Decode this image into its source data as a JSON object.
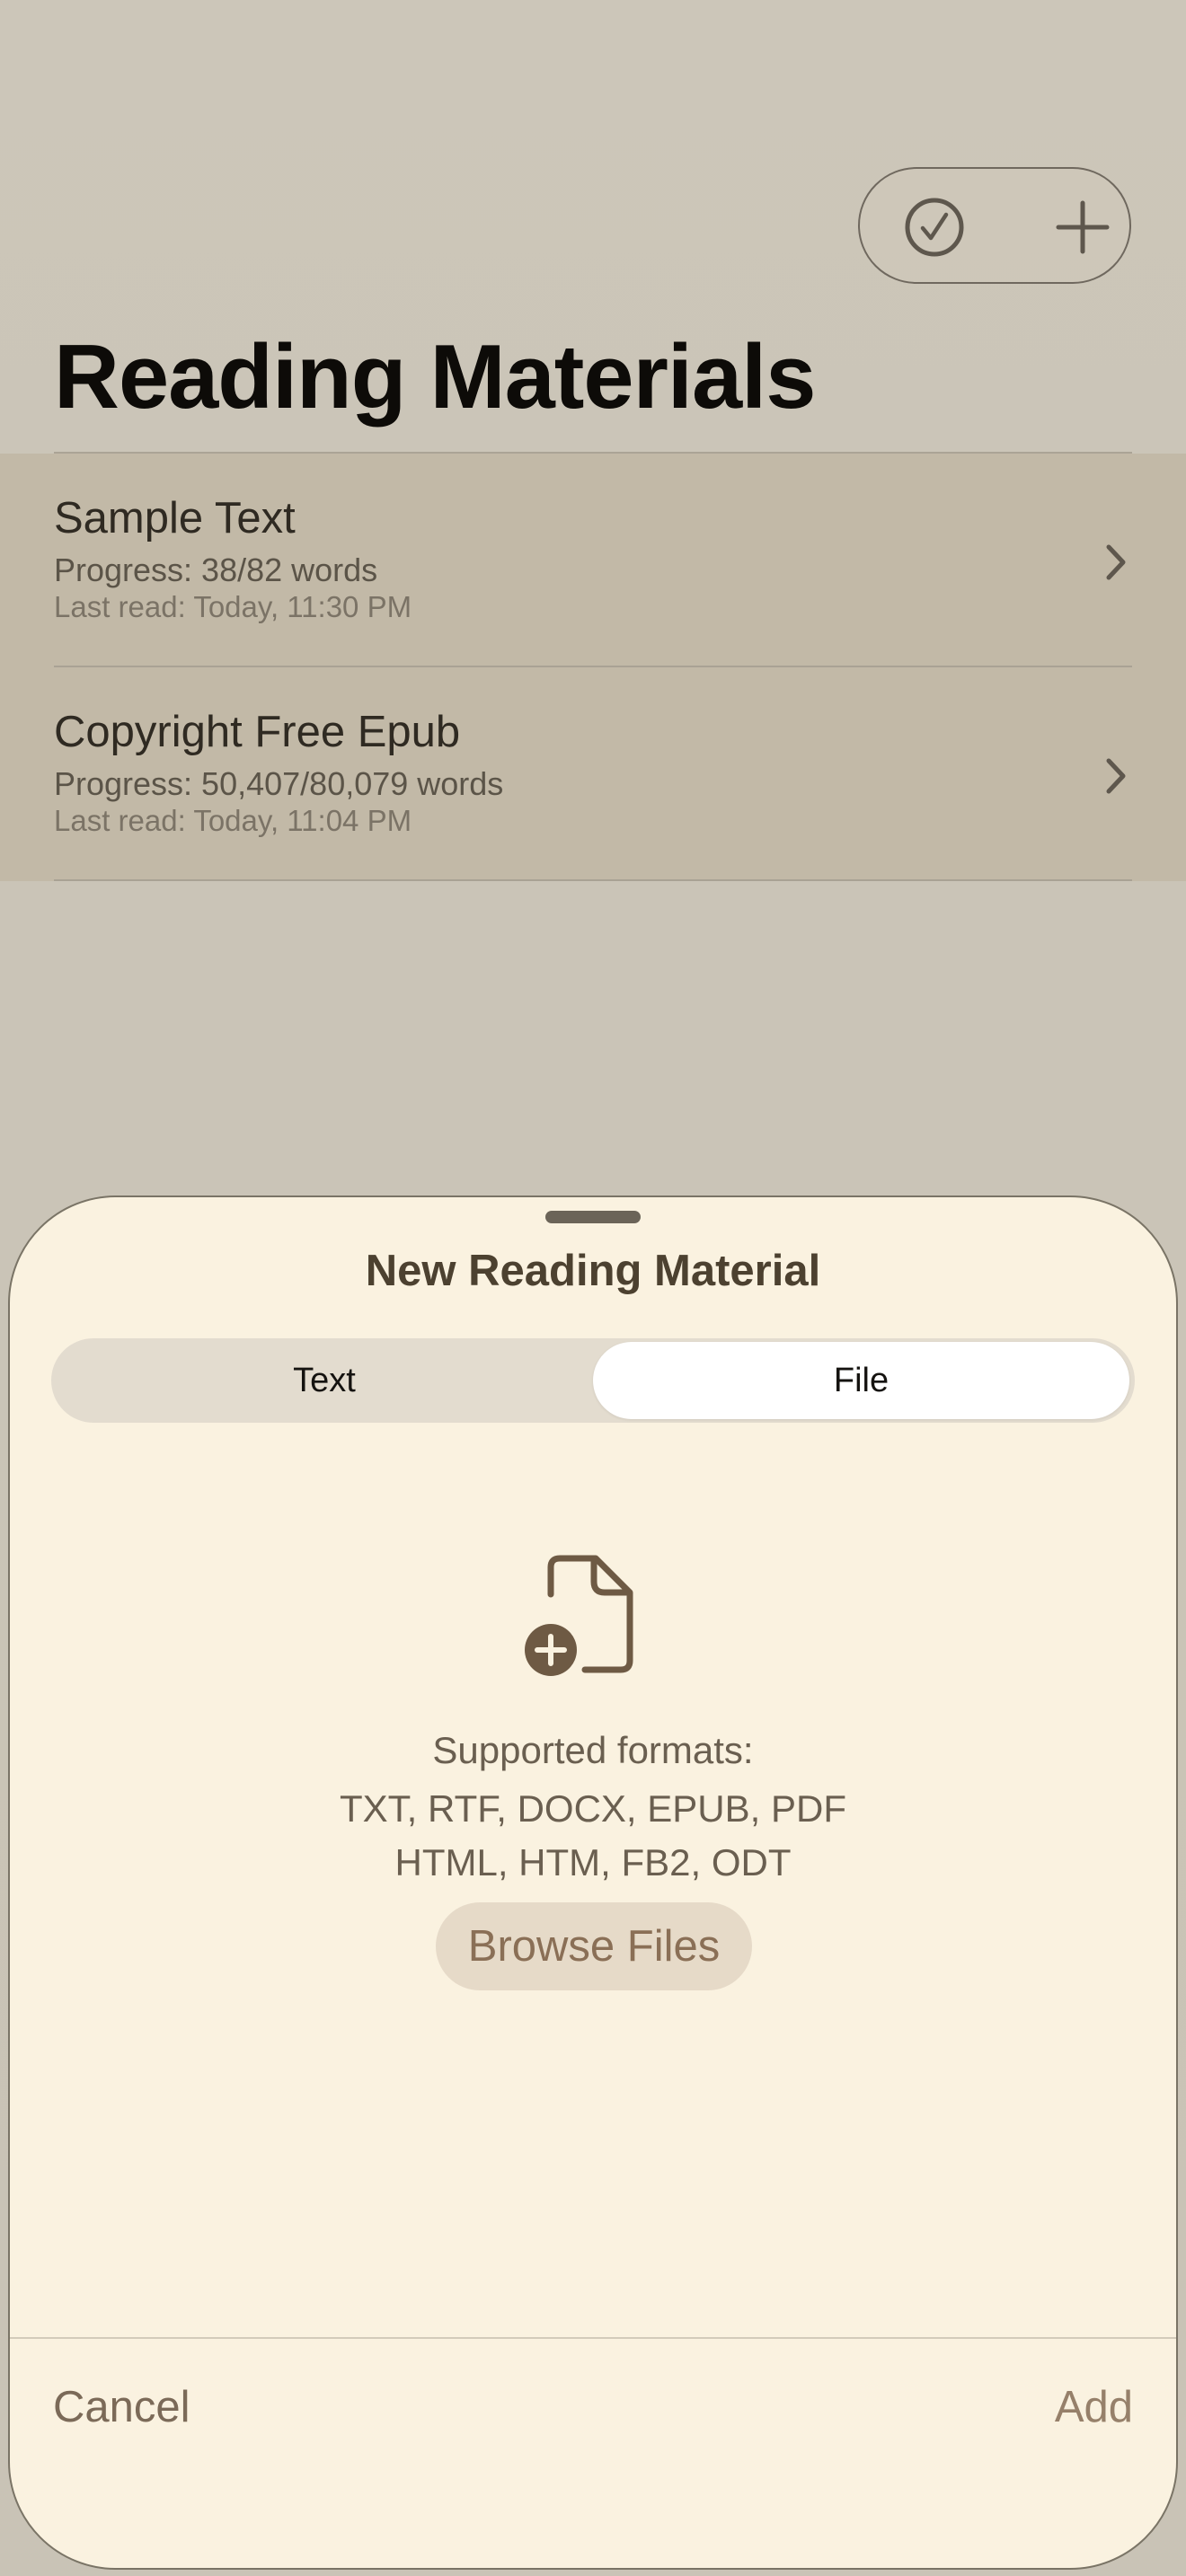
{
  "toolbar": {
    "select_icon": "checkmark-circle-icon",
    "add_icon": "plus-icon"
  },
  "page": {
    "title": "Reading Materials"
  },
  "materials": [
    {
      "title": "Sample Text",
      "progress": "Progress: 38/82 words",
      "last_read": "Last read: Today, 11:30 PM",
      "progress_fraction": 0.463
    },
    {
      "title": "Copyright Free Epub",
      "progress": "Progress: 50,407/80,079 words",
      "last_read": "Last read: Today, 11:04 PM",
      "progress_fraction": 0.629
    }
  ],
  "sheet": {
    "title": "New Reading Material",
    "segments": [
      "Text",
      "File"
    ],
    "selected_segment": "File",
    "file_icon": "document-add-icon",
    "formats_label": "Supported formats:",
    "formats_line1": "TXT, RTF, DOCX, EPUB, PDF",
    "formats_line2": "HTML, HTM, FB2, ODT",
    "browse_label": "Browse Files",
    "cancel_label": "Cancel",
    "add_label": "Add"
  },
  "colors": {
    "background": "#cac4b7",
    "row_background": "#c2b9a7",
    "sheet_background": "#faf2e0",
    "accent": "#8a6f56"
  }
}
